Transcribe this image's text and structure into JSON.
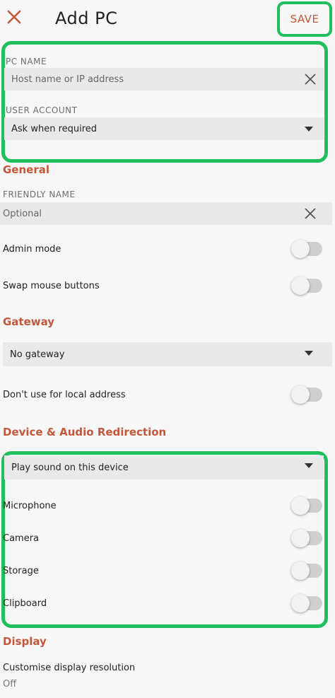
{
  "header": {
    "title": "Add PC",
    "save_label": "SAVE",
    "close_icon": "close-icon",
    "accent_color": "#c4573a",
    "highlight_color": "#1fbf5e"
  },
  "pc_name": {
    "label": "PC NAME",
    "placeholder": "Host name or IP address"
  },
  "user_account": {
    "label": "USER ACCOUNT",
    "value": "Ask when required"
  },
  "general": {
    "title": "General",
    "friendly_name_label": "FRIENDLY NAME",
    "friendly_name_placeholder": "Optional",
    "admin_mode_label": "Admin mode",
    "admin_mode_on": false,
    "swap_mouse_label": "Swap mouse buttons",
    "swap_mouse_on": false
  },
  "gateway": {
    "title": "Gateway",
    "value": "No gateway",
    "local_label": "Don't use for local address",
    "local_on": false
  },
  "device_audio": {
    "title": "Device & Audio Redirection",
    "sound_value": "Play sound on this device",
    "items": [
      {
        "label": "Microphone",
        "on": false
      },
      {
        "label": "Camera",
        "on": false
      },
      {
        "label": "Storage",
        "on": false
      },
      {
        "label": "Clipboard",
        "on": false
      }
    ]
  },
  "display": {
    "title": "Display",
    "resolution_label": "Customise display resolution",
    "resolution_value": "Off"
  }
}
